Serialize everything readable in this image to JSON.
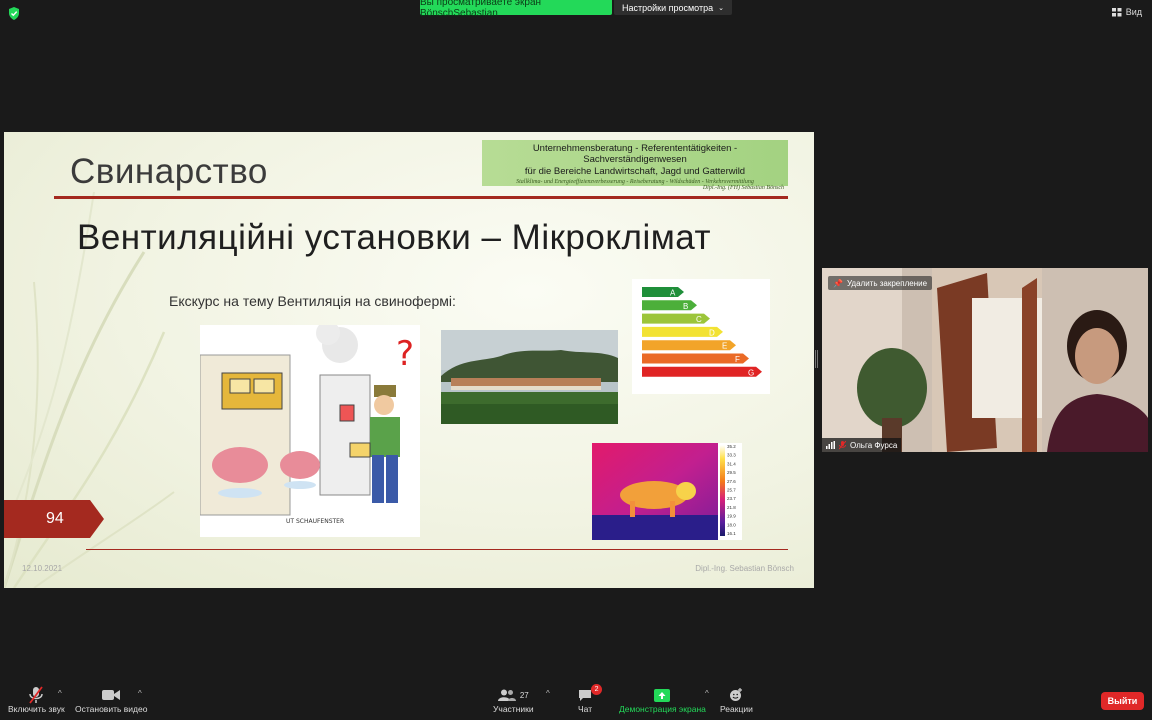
{
  "top_bar": {
    "share_banner": "Вы просматриваете экран BönschSebastian",
    "view_settings": "Настройки просмотра",
    "view_button": "Вид"
  },
  "slide": {
    "title": "Свинарство",
    "logo": {
      "line1": "Unternehmensberatung  -  Referententätigkeiten  -  Sachverständigenwesen",
      "line2": "für die Bereiche Landwirtschaft, Jagd und Gatterwild",
      "line3": "Stallklima- und Energieeffizienzverbesserung - Reiseberatung - Wildschäden - Verkehrsvermittlung",
      "line4": "Dipl.-Ing. (FH) Sebastian Bönsch"
    },
    "subtitle": "Вентиляційні установки – Мікроклімат",
    "excurs": "Екскурс на тему Вентиляція на свинофермі:",
    "page_number": "94",
    "date": "12.10.2021",
    "author": "Dipl.-Ing. Sebastian Bönsch",
    "energy_labels": [
      "A",
      "B",
      "C",
      "D",
      "E",
      "F",
      "G"
    ],
    "energy_colors": [
      "#1f8f3a",
      "#4caf3a",
      "#9cc53a",
      "#f2e233",
      "#f2a429",
      "#ea6a26",
      "#e02424"
    ],
    "thermal_scale": [
      "35.2",
      "33.3",
      "31.4",
      "29.5",
      "27.6",
      "25.7",
      "23.7",
      "21.8",
      "19.9",
      "18.0",
      "16.1"
    ],
    "cartoon_caption": "UT SCHAUFENSTER"
  },
  "video": {
    "unpin": "Удалить закрепление",
    "participant_name": "Ольга Фурса"
  },
  "toolbar": {
    "mute": "Включить звук",
    "video": "Остановить видео",
    "participants": "Участники",
    "participants_count": "27",
    "chat": "Чат",
    "chat_badge": "2",
    "share": "Демонстрация экрана",
    "reactions": "Реакции",
    "leave": "Выйти"
  }
}
